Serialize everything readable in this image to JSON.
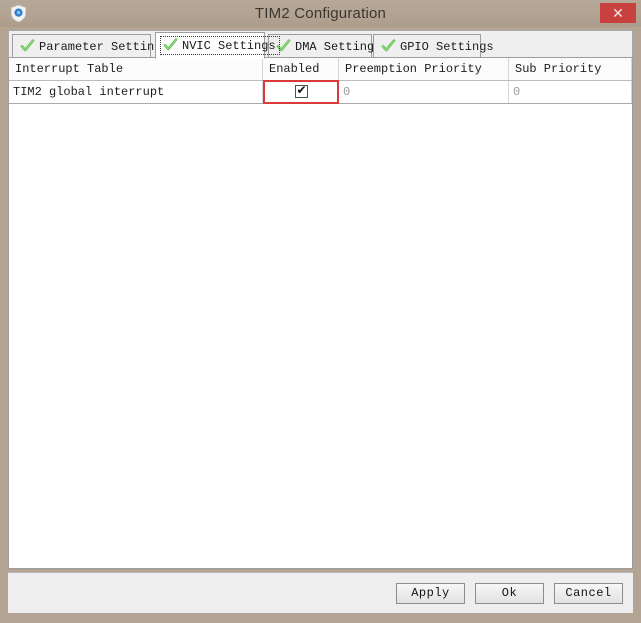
{
  "window": {
    "title": "TIM2 Configuration",
    "icon": "shield-icon",
    "close_label": "✕",
    "titlebar_color": "#b3a494",
    "close_color": "#c9413f"
  },
  "tabs": [
    {
      "label": "Parameter Settings",
      "icon": "green-check-icon",
      "active": false
    },
    {
      "label": "NVIC Settings",
      "icon": "green-check-icon",
      "active": true
    },
    {
      "label": "DMA Settings",
      "icon": "green-check-icon",
      "active": false
    },
    {
      "label": "GPIO Settings",
      "icon": "green-check-icon",
      "active": false
    }
  ],
  "table": {
    "columns": [
      "Interrupt Table",
      "Enabled",
      "Preemption Priority",
      "Sub Priority"
    ],
    "rows": [
      {
        "interrupt_table": "TIM2 global interrupt",
        "enabled": true,
        "enabled_glyph": "✔",
        "preemption_priority": "0",
        "sub_priority": "0",
        "selected_cell": "enabled"
      }
    ],
    "selection_color": "#d93a3a"
  },
  "footer": {
    "apply_label": "Apply",
    "ok_label": "Ok",
    "cancel_label": "Cancel"
  }
}
